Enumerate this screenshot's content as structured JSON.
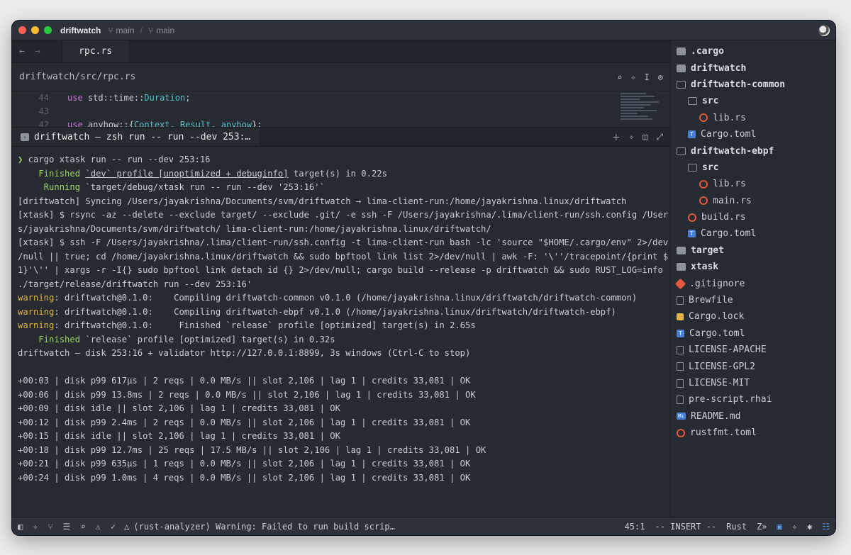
{
  "titlebar": {
    "project": "driftwatch",
    "branch_a": "main",
    "branch_b": "main"
  },
  "editor": {
    "tab_label": "rpc.rs",
    "breadcrumb": "driftwatch/src/rpc.rs",
    "lines": [
      {
        "num": "44",
        "kw": "use",
        "rest_a": " std::time::",
        "ty": "Duration",
        "rest_b": ";"
      },
      {
        "num": "43",
        "kw": "",
        "rest_a": "",
        "ty": "",
        "rest_b": ""
      },
      {
        "num": "42",
        "kw": "use",
        "rest_a": " anyhow::{",
        "ty": "Context, Result, anyhow",
        "rest_b": "};"
      }
    ]
  },
  "terminal": {
    "tab_label": "driftwatch — zsh run -- run --dev 253:…",
    "prompt_symbol": "❯",
    "command": " cargo xtask run -- run --dev 253:16",
    "finished1_label": "    Finished",
    "finished1_text_a": " ",
    "finished1_underlined": "`dev` profile [unoptimized + debuginfo]",
    "finished1_text_b": " target(s) in 0.22s",
    "running_label": "     Running",
    "running_text": " `target/debug/xtask run -- run --dev '253:16'`",
    "sync_line": "[driftwatch] Syncing /Users/jayakrishna/Documents/svm/driftwatch → lima-client-run:/home/jayakrishna.linux/driftwatch",
    "rsync_line1": "[xtask] $ rsync -az --delete --exclude target/ --exclude .git/ -e ssh -F /Users/jayakrishna/.lima/client-run/ssh.config /User",
    "rsync_line2": "s/jayakrishna/Documents/svm/driftwatch/ lima-client-run:/home/jayakrishna.linux/driftwatch/",
    "ssh_line1": "[xtask] $ ssh -F /Users/jayakrishna/.lima/client-run/ssh.config -t lima-client-run bash -lc 'source \"$HOME/.cargo/env\" 2>/dev",
    "ssh_line2": "/null || true; cd /home/jayakrishna.linux/driftwatch && sudo bpftool link list 2>/dev/null | awk -F: '\\''/tracepoint/{print $",
    "ssh_line3": "1}'\\'' | xargs -r -I{} sudo bpftool link detach id {} 2>/dev/null; cargo build --release -p driftwatch && sudo RUST_LOG=info",
    "ssh_line4": "./target/release/driftwatch run --dev 253:16'",
    "warnings": [
      {
        "label": "warning",
        "text": ": driftwatch@0.1.0:    Compiling driftwatch-common v0.1.0 (/home/jayakrishna.linux/driftwatch/driftwatch-common)"
      },
      {
        "label": "warning",
        "text": ": driftwatch@0.1.0:    Compiling driftwatch-ebpf v0.1.0 (/home/jayakrishna.linux/driftwatch/driftwatch-ebpf)"
      },
      {
        "label": "warning",
        "text": ": driftwatch@0.1.0:     Finished `release` profile [optimized] target(s) in 2.65s"
      }
    ],
    "finished2_label": "    Finished",
    "finished2_text": " `release` profile [optimized] target(s) in 0.32s",
    "header_line": "driftwatch — disk 253:16 + validator http://127.0.0.1:8899, 3s windows (Ctrl-C to stop)",
    "stats": [
      "+00:03 | disk p99 617µs | 2 reqs | 0.0 MB/s || slot 2,106 | lag 1 | credits 33,081 | OK",
      "+00:06 | disk p99 13.8ms | 2 reqs | 0.0 MB/s || slot 2,106 | lag 1 | credits 33,081 | OK",
      "+00:09 | disk idle || slot 2,106 | lag 1 | credits 33,081 | OK",
      "+00:12 | disk p99 2.4ms | 2 reqs | 0.0 MB/s || slot 2,106 | lag 1 | credits 33,081 | OK",
      "+00:15 | disk idle || slot 2,106 | lag 1 | credits 33,081 | OK",
      "+00:18 | disk p99 12.7ms | 25 reqs | 17.5 MB/s || slot 2,106 | lag 1 | credits 33,081 | OK",
      "+00:21 | disk p99 635µs | 1 reqs | 0.0 MB/s || slot 2,106 | lag 1 | credits 33,081 | OK",
      "+00:24 | disk p99 1.0ms | 4 reqs | 0.0 MB/s || slot 2,106 | lag 1 | credits 33,081 | OK"
    ]
  },
  "sidebar": {
    "items": [
      {
        "label": ".cargo",
        "icon": "folder-icon",
        "depth": 0,
        "dir": true
      },
      {
        "label": "driftwatch",
        "icon": "folder-icon",
        "depth": 0,
        "dir": true
      },
      {
        "label": "driftwatch-common",
        "icon": "folder-open-icon",
        "depth": 0,
        "dir": true
      },
      {
        "label": "src",
        "icon": "folder-open-icon",
        "depth": 1,
        "dir": true
      },
      {
        "label": "lib.rs",
        "icon": "rust-file-icon",
        "depth": 2,
        "dir": false
      },
      {
        "label": "Cargo.toml",
        "icon": "toml-file-icon",
        "depth": 1,
        "dir": false
      },
      {
        "label": "driftwatch-ebpf",
        "icon": "folder-open-icon",
        "depth": 0,
        "dir": true
      },
      {
        "label": "src",
        "icon": "folder-open-icon",
        "depth": 1,
        "dir": true
      },
      {
        "label": "lib.rs",
        "icon": "rust-file-icon",
        "depth": 2,
        "dir": false
      },
      {
        "label": "main.rs",
        "icon": "rust-file-icon",
        "depth": 2,
        "dir": false
      },
      {
        "label": "build.rs",
        "icon": "rust-file-icon",
        "depth": 1,
        "dir": false
      },
      {
        "label": "Cargo.toml",
        "icon": "toml-file-icon",
        "depth": 1,
        "dir": false
      },
      {
        "label": "target",
        "icon": "folder-icon",
        "depth": 0,
        "dir": true
      },
      {
        "label": "xtask",
        "icon": "folder-icon",
        "depth": 0,
        "dir": true
      },
      {
        "label": ".gitignore",
        "icon": "git-icon",
        "depth": 0,
        "dir": false
      },
      {
        "label": "Brewfile",
        "icon": "file-icon",
        "depth": 0,
        "dir": false
      },
      {
        "label": "Cargo.lock",
        "icon": "lock-icon",
        "depth": 0,
        "dir": false
      },
      {
        "label": "Cargo.toml",
        "icon": "toml-file-icon",
        "depth": 0,
        "dir": false
      },
      {
        "label": "LICENSE-APACHE",
        "icon": "file-icon",
        "depth": 0,
        "dir": false
      },
      {
        "label": "LICENSE-GPL2",
        "icon": "file-icon",
        "depth": 0,
        "dir": false
      },
      {
        "label": "LICENSE-MIT",
        "icon": "file-icon",
        "depth": 0,
        "dir": false
      },
      {
        "label": "pre-script.rhai",
        "icon": "file-icon",
        "depth": 0,
        "dir": false
      },
      {
        "label": "README.md",
        "icon": "markdown-file-icon",
        "depth": 0,
        "dir": false
      },
      {
        "label": "rustfmt.toml",
        "icon": "rust-file-icon",
        "depth": 0,
        "dir": false
      }
    ]
  },
  "statusbar": {
    "warning": "(rust-analyzer) Warning: Failed to run build scrip…",
    "cursor": "45:1",
    "mode": "-- INSERT --",
    "language": "Rust"
  }
}
